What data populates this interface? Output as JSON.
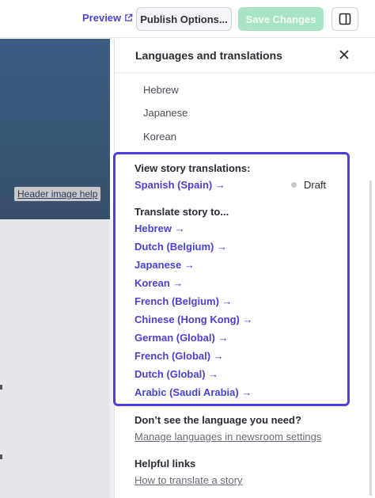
{
  "toolbar": {
    "preview_label": "Preview",
    "publish_label": "Publish Options...",
    "save_label": "Save Changes"
  },
  "hero": {
    "help_label": "Header image help"
  },
  "panel": {
    "title": "Languages and translations",
    "plain_languages": [
      "Hebrew",
      "Japanese",
      "Korean"
    ],
    "view_heading": "View story translations:",
    "existing": {
      "language": "Spanish (Spain) →",
      "status": "Draft"
    },
    "translate_heading": "Translate story to...",
    "translate_links": [
      "Hebrew →",
      "Dutch (Belgium) →",
      "Japanese →",
      "Korean →",
      "French (Belgium) →",
      "Chinese (Hong Kong) →",
      "German (Global) →",
      "French (Global) →",
      "Dutch (Global) →",
      "Arabic (Saudi Arabia) →"
    ],
    "missing_heading": "Don’t see the language you need?",
    "missing_link": "Manage languages in newsroom settings",
    "helpful_heading": "Helpful links",
    "helpful_link": "How to translate a story"
  },
  "colors": {
    "accent": "#4b3fd6",
    "focus_border": "#4b3fe0",
    "save_disabled": "#a9e3c5"
  }
}
